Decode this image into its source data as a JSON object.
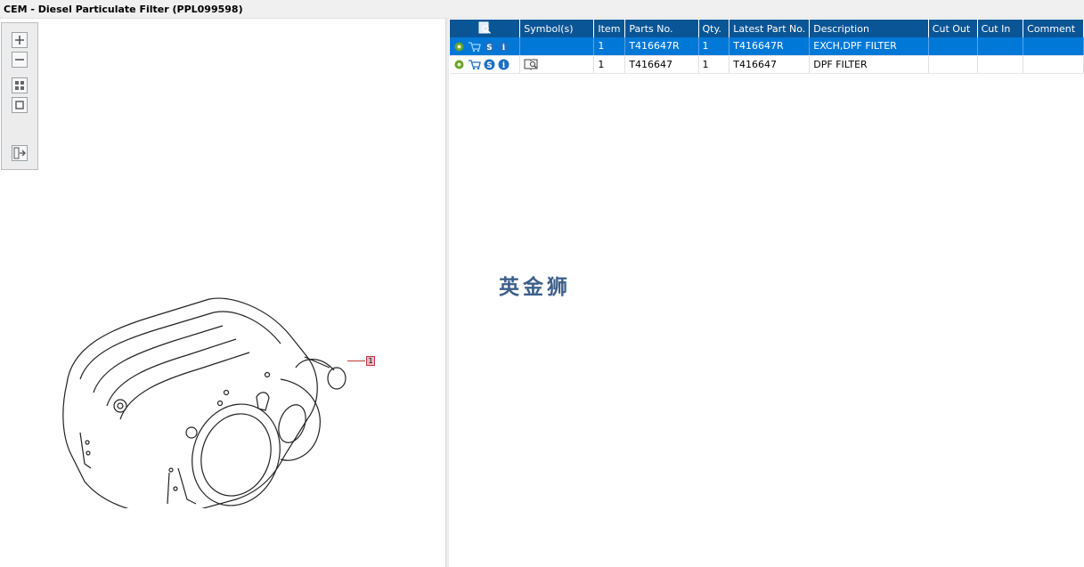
{
  "window": {
    "title": "CEM - Diesel Particulate Filter (PPL099598)"
  },
  "toolbar": {
    "buttons": [
      {
        "name": "zoom-in-button",
        "icon": "zoom-in-icon"
      },
      {
        "name": "zoom-out-button",
        "icon": "zoom-out-icon"
      },
      {
        "name": "fit-window-button",
        "icon": "fit-window-icon"
      },
      {
        "name": "actual-size-button",
        "icon": "actual-size-icon"
      },
      {
        "name": "export-button",
        "icon": "export-arrow-icon"
      }
    ]
  },
  "drawing": {
    "callout_label": "1"
  },
  "table": {
    "header_icon": "search-list-icon",
    "columns": [
      "Symbol(s)",
      "Item",
      "Parts No.",
      "Qty.",
      "Latest Part No.",
      "Description",
      "Cut Out",
      "Cut In",
      "Comment"
    ],
    "rows": [
      {
        "selected": true,
        "icons": [
          "gear-icon",
          "cart-icon",
          "s-icon",
          "info-icon"
        ],
        "symbol_icon": "",
        "item": "1",
        "parts_no": "T416647R",
        "qty": "1",
        "latest_part_no": "T416647R",
        "description": "EXCH,DPF FILTER",
        "cut_out": "",
        "cut_in": "",
        "comment": ""
      },
      {
        "selected": false,
        "icons": [
          "gear-icon",
          "cart-icon",
          "s-icon",
          "info-icon"
        ],
        "symbol_icon": "book-search-icon",
        "item": "1",
        "parts_no": "T416647",
        "qty": "1",
        "latest_part_no": "T416647",
        "description": "DPF FILTER",
        "cut_out": "",
        "cut_in": "",
        "comment": ""
      }
    ]
  },
  "watermark": {
    "text": "英金狮"
  },
  "colors": {
    "header_bg": "#0a5596",
    "selected_row": "#0078d7",
    "callout": "#c23a3a"
  }
}
